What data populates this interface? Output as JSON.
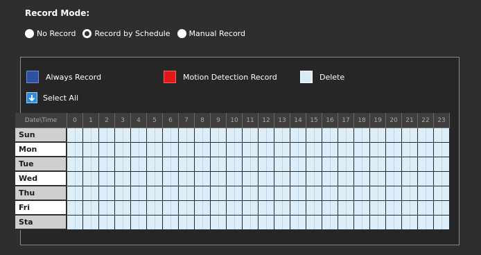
{
  "record_mode": {
    "title": "Record Mode:",
    "options": [
      {
        "label": "No Record",
        "selected": false
      },
      {
        "label": "Record by Schedule",
        "selected": true
      },
      {
        "label": "Manual Record",
        "selected": false
      }
    ]
  },
  "legend": {
    "always_record": "Always Record",
    "motion_detection_record": "Motion Detection Record",
    "delete": "Delete",
    "select_all": "Select All"
  },
  "schedule": {
    "corner_label": "Date\\Time",
    "hours": [
      "0",
      "1",
      "2",
      "3",
      "4",
      "5",
      "6",
      "7",
      "8",
      "9",
      "10",
      "11",
      "12",
      "13",
      "14",
      "15",
      "16",
      "17",
      "18",
      "19",
      "20",
      "21",
      "22",
      "23"
    ],
    "days": [
      "Sun",
      "Mon",
      "Tue",
      "Wed",
      "Thu",
      "Fri",
      "Sta"
    ]
  },
  "colors": {
    "always_record": "#2f4f9f",
    "motion_detection_record": "#e01818",
    "delete": "#d8ecf8",
    "slot_empty": "#ddeef9"
  }
}
